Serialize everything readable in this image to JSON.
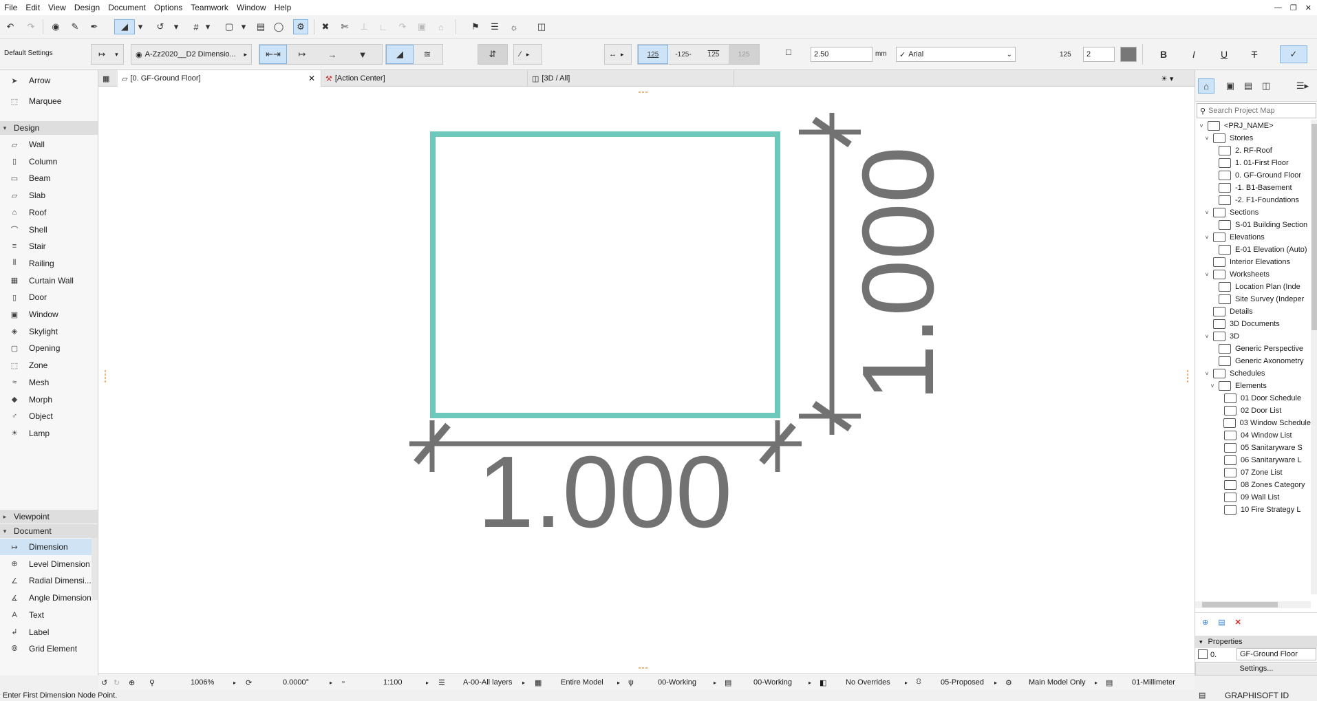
{
  "menu": {
    "items": [
      "File",
      "Edit",
      "View",
      "Design",
      "Document",
      "Options",
      "Teamwork",
      "Window",
      "Help"
    ]
  },
  "toolbar2": {
    "default_settings": "Default Settings",
    "layer_value": "A-Zz2020__D2 Dimensio...",
    "font_size_value": "2.50",
    "font_size_unit": "mm",
    "font_name": "Arial",
    "pen_value": "2",
    "bold_label": "B",
    "italic_label": "I",
    "underline_label": "U",
    "strike_label": "T",
    "text_sample_1": "125",
    "text_sample_2": "-125-",
    "text_sample_3": "125",
    "text_sample_4": "125",
    "pen_icon_label": "125"
  },
  "toolbox": {
    "tools_top": [
      {
        "label": "Arrow",
        "icon": "arrow-icon"
      },
      {
        "label": "Marquee",
        "icon": "marquee-icon"
      }
    ],
    "design_label": "Design",
    "design_tools": [
      {
        "label": "Wall",
        "icon": "wall-icon"
      },
      {
        "label": "Column",
        "icon": "column-icon"
      },
      {
        "label": "Beam",
        "icon": "beam-icon"
      },
      {
        "label": "Slab",
        "icon": "slab-icon"
      },
      {
        "label": "Roof",
        "icon": "roof-icon"
      },
      {
        "label": "Shell",
        "icon": "shell-icon"
      },
      {
        "label": "Stair",
        "icon": "stair-icon"
      },
      {
        "label": "Railing",
        "icon": "railing-icon"
      },
      {
        "label": "Curtain Wall",
        "icon": "curtain-wall-icon"
      },
      {
        "label": "Door",
        "icon": "door-icon"
      },
      {
        "label": "Window",
        "icon": "window-icon"
      },
      {
        "label": "Skylight",
        "icon": "skylight-icon"
      },
      {
        "label": "Opening",
        "icon": "opening-icon"
      },
      {
        "label": "Zone",
        "icon": "zone-icon"
      },
      {
        "label": "Mesh",
        "icon": "mesh-icon"
      },
      {
        "label": "Morph",
        "icon": "morph-icon"
      },
      {
        "label": "Object",
        "icon": "object-icon"
      },
      {
        "label": "Lamp",
        "icon": "lamp-icon"
      }
    ],
    "viewpoint_label": "Viewpoint",
    "document_label": "Document",
    "document_tools": [
      {
        "label": "Dimension",
        "icon": "dimension-icon"
      },
      {
        "label": "Level Dimension",
        "icon": "level-dimension-icon"
      },
      {
        "label": "Radial Dimensi...",
        "icon": "radial-dimension-icon"
      },
      {
        "label": "Angle Dimension",
        "icon": "angle-dimension-icon"
      },
      {
        "label": "Text",
        "icon": "text-icon"
      },
      {
        "label": "Label",
        "icon": "label-icon"
      },
      {
        "label": "Grid Element",
        "icon": "grid-element-icon"
      }
    ]
  },
  "tabs": [
    {
      "label": "[0. GF-Ground Floor]"
    },
    {
      "label": "[Action Center]"
    },
    {
      "label": "[3D / All]"
    }
  ],
  "drawing": {
    "horizontal_dimension": "1.000",
    "vertical_dimension": "1.000",
    "square_color": "#6cc9bb",
    "dimension_color": "#727272"
  },
  "navigator": {
    "search_placeholder": "Search Project Map",
    "items": [
      {
        "label": "<PRJ_NAME>",
        "exp": "v"
      },
      {
        "label": "Stories",
        "exp": "v"
      },
      {
        "label": "2. RF-Roof",
        "exp": ""
      },
      {
        "label": "1. 01-First Floor",
        "exp": ""
      },
      {
        "label": "0. GF-Ground Floor",
        "exp": ""
      },
      {
        "label": "-1. B1-Basement",
        "exp": ""
      },
      {
        "label": "-2. F1-Foundations",
        "exp": ""
      },
      {
        "label": "Sections",
        "exp": "v"
      },
      {
        "label": "S-01 Building Section",
        "exp": ""
      },
      {
        "label": "Elevations",
        "exp": "v"
      },
      {
        "label": "E-01 Elevation (Auto)",
        "exp": ""
      },
      {
        "label": "Interior Elevations",
        "exp": ""
      },
      {
        "label": "Worksheets",
        "exp": "v"
      },
      {
        "label": "Location Plan (Inde",
        "exp": ""
      },
      {
        "label": "Site Survey (Indeper",
        "exp": ""
      },
      {
        "label": "Details",
        "exp": ""
      },
      {
        "label": "3D Documents",
        "exp": ""
      },
      {
        "label": "3D",
        "exp": "v"
      },
      {
        "label": "Generic Perspective",
        "exp": ""
      },
      {
        "label": "Generic Axonometry",
        "exp": ""
      },
      {
        "label": "Schedules",
        "exp": "v"
      },
      {
        "label": "Elements",
        "exp": "v"
      },
      {
        "label": "01 Door Schedule",
        "exp": ""
      },
      {
        "label": "02 Door List",
        "exp": ""
      },
      {
        "label": "03 Window Schedule",
        "exp": ""
      },
      {
        "label": "04 Window List",
        "exp": ""
      },
      {
        "label": "05 Sanitaryware S",
        "exp": ""
      },
      {
        "label": "06 Sanitaryware L",
        "exp": ""
      },
      {
        "label": "07 Zone List",
        "exp": ""
      },
      {
        "label": "08 Zones Category",
        "exp": ""
      },
      {
        "label": "09 Wall List",
        "exp": ""
      },
      {
        "label": "10 Fire Strategy L",
        "exp": ""
      }
    ],
    "properties_label": "Properties",
    "prop_id": "0.",
    "prop_value": "GF-Ground Floor",
    "settings_button": "Settings..."
  },
  "bottombar": {
    "zoom": "1006%",
    "angle": "0.0000°",
    "scale": "1:100",
    "layers": "A-00-All layers",
    "model_view": "Entire Model",
    "pen_set": "00-Working",
    "model_option": "00-Working",
    "overrides": "No Overrides",
    "renovation": "05-Proposed",
    "structure": "Main Model Only",
    "dimension": "01-Millimeter"
  },
  "status": {
    "message": "Enter First Dimension Node Point.",
    "brand": "GRAPHISOFT ID"
  }
}
